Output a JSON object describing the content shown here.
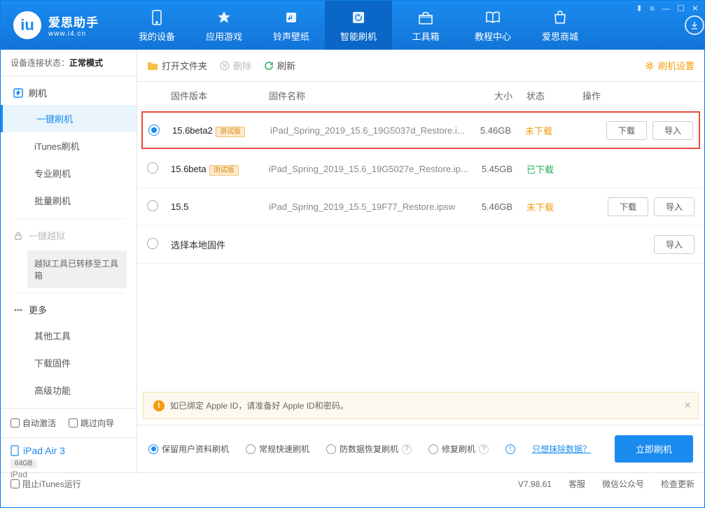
{
  "app": {
    "name": "爱思助手",
    "url": "www.i4.cn"
  },
  "nav": [
    {
      "label": "我的设备"
    },
    {
      "label": "应用游戏"
    },
    {
      "label": "铃声壁纸"
    },
    {
      "label": "智能刷机"
    },
    {
      "label": "工具箱"
    },
    {
      "label": "教程中心"
    },
    {
      "label": "爱思商城"
    }
  ],
  "sidebar": {
    "conn_label": "设备连接状态：",
    "conn_value": "正常模式",
    "flash_header": "刷机",
    "items1": [
      "一键刷机",
      "iTunes刷机",
      "专业刷机",
      "批量刷机"
    ],
    "jailbreak_header": "一键越狱",
    "jb_note": "越狱工具已转移至工具箱",
    "more_header": "更多",
    "items2": [
      "其他工具",
      "下载固件",
      "高级功能"
    ],
    "cb_autoactivate": "自动激活",
    "cb_skipguide": "跳过向导",
    "device_name": "iPad Air 3",
    "device_cap": "64GB",
    "device_type": "iPad"
  },
  "toolbar": {
    "open_folder": "打开文件夹",
    "delete": "删除",
    "refresh": "刷新",
    "settings": "刷机设置"
  },
  "table": {
    "col_version": "固件版本",
    "col_name": "固件名称",
    "col_size": "大小",
    "col_status": "状态",
    "col_action": "操作"
  },
  "firmware": [
    {
      "version": "15.6beta2",
      "beta": "测试版",
      "name": "iPad_Spring_2019_15.6_19G5037d_Restore.i...",
      "size": "5.46GB",
      "status": "未下载",
      "status_color": "orange",
      "selected": true,
      "highlighted": true,
      "show_download": true
    },
    {
      "version": "15.6beta",
      "beta": "测试版",
      "name": "iPad_Spring_2019_15.6_19G5027e_Restore.ip...",
      "size": "5.45GB",
      "status": "已下载",
      "status_color": "green",
      "selected": false,
      "highlighted": false,
      "show_download": false
    },
    {
      "version": "15.5",
      "beta": "",
      "name": "iPad_Spring_2019_15.5_19F77_Restore.ipsw",
      "size": "5.46GB",
      "status": "未下载",
      "status_color": "orange",
      "selected": false,
      "highlighted": false,
      "show_download": true
    }
  ],
  "local_fw": "选择本地固件",
  "btn_download": "下载",
  "btn_import": "导入",
  "notice": "如已绑定 Apple ID，请准备好 Apple ID和密码。",
  "flash_opts": {
    "opt1": "保留用户资料刷机",
    "opt2": "常规快速刷机",
    "opt3": "防数据恢复刷机",
    "opt4": "修复刷机",
    "erase_link": "只想抹除数据？",
    "flash_btn": "立即刷机"
  },
  "footer": {
    "block_itunes": "阻止iTunes运行",
    "version": "V7.98.61",
    "kefu": "客服",
    "wechat": "微信公众号",
    "update": "检查更新"
  }
}
